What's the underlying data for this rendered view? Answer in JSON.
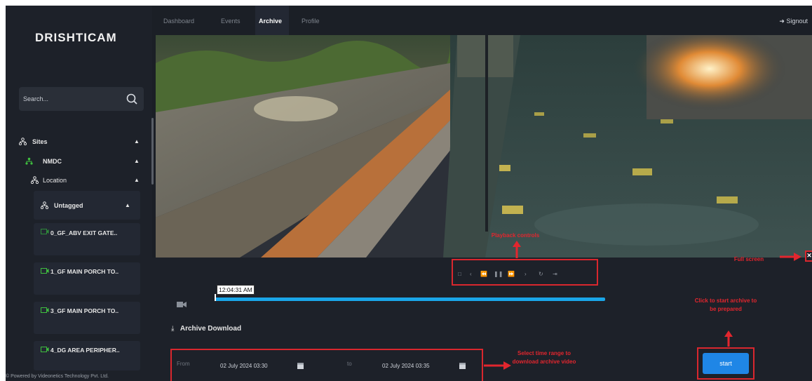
{
  "brand": {
    "logo_text": "DRISHTICAM"
  },
  "nav": {
    "tabs": [
      {
        "label": "Dashboard",
        "active": false
      },
      {
        "label": "Events",
        "active": false
      },
      {
        "label": "Archive",
        "active": true
      },
      {
        "label": "Profile",
        "active": false
      }
    ],
    "signout_label": "Signout"
  },
  "sidebar": {
    "search_placeholder": "Search...",
    "tree": {
      "sites_label": "Sites",
      "site_name": "NMDC",
      "location_label": "Location",
      "group_label": "Untagged"
    },
    "cameras": [
      {
        "label": "0_GF_ABV EXIT GATE..",
        "status": "offline"
      },
      {
        "label": "1_GF MAIN PORCH TO..",
        "status": "online"
      },
      {
        "label": "3_GF MAIN PORCH TO..",
        "status": "online"
      },
      {
        "label": "4_DG AREA PERIPHER..",
        "status": "online"
      }
    ],
    "footer": "© Powered by Videonetics Technology Pvt. Ltd."
  },
  "playback": {
    "current_time": "12:04:31 AM",
    "progress": 0.0
  },
  "archive": {
    "title": "Archive Download",
    "from_label": "From",
    "from_value": "02 July 2024 03:30",
    "to_label": "to",
    "to_value": "02 July 2024 03:35",
    "start_label": "start"
  },
  "annotations": {
    "playback_controls": "Playback controls",
    "full_screen": "Full screen",
    "select_time_range": "Select time range to download archive video",
    "click_to_start": "Click to start archive to be prepared"
  },
  "colors": {
    "accent": "#1f86e6",
    "timeline": "#1aa6e8",
    "annotation": "#d9272e",
    "camera_online": "#3fbf3f",
    "camera_offline": "#2e8b3a"
  },
  "icons": {
    "search": "search-icon",
    "sites": "sitemap-icon",
    "camera": "video-camera-icon",
    "download": "download-icon",
    "calendar": "calendar-icon",
    "signout": "signout-icon",
    "fullscreen": "fullscreen-icon"
  }
}
